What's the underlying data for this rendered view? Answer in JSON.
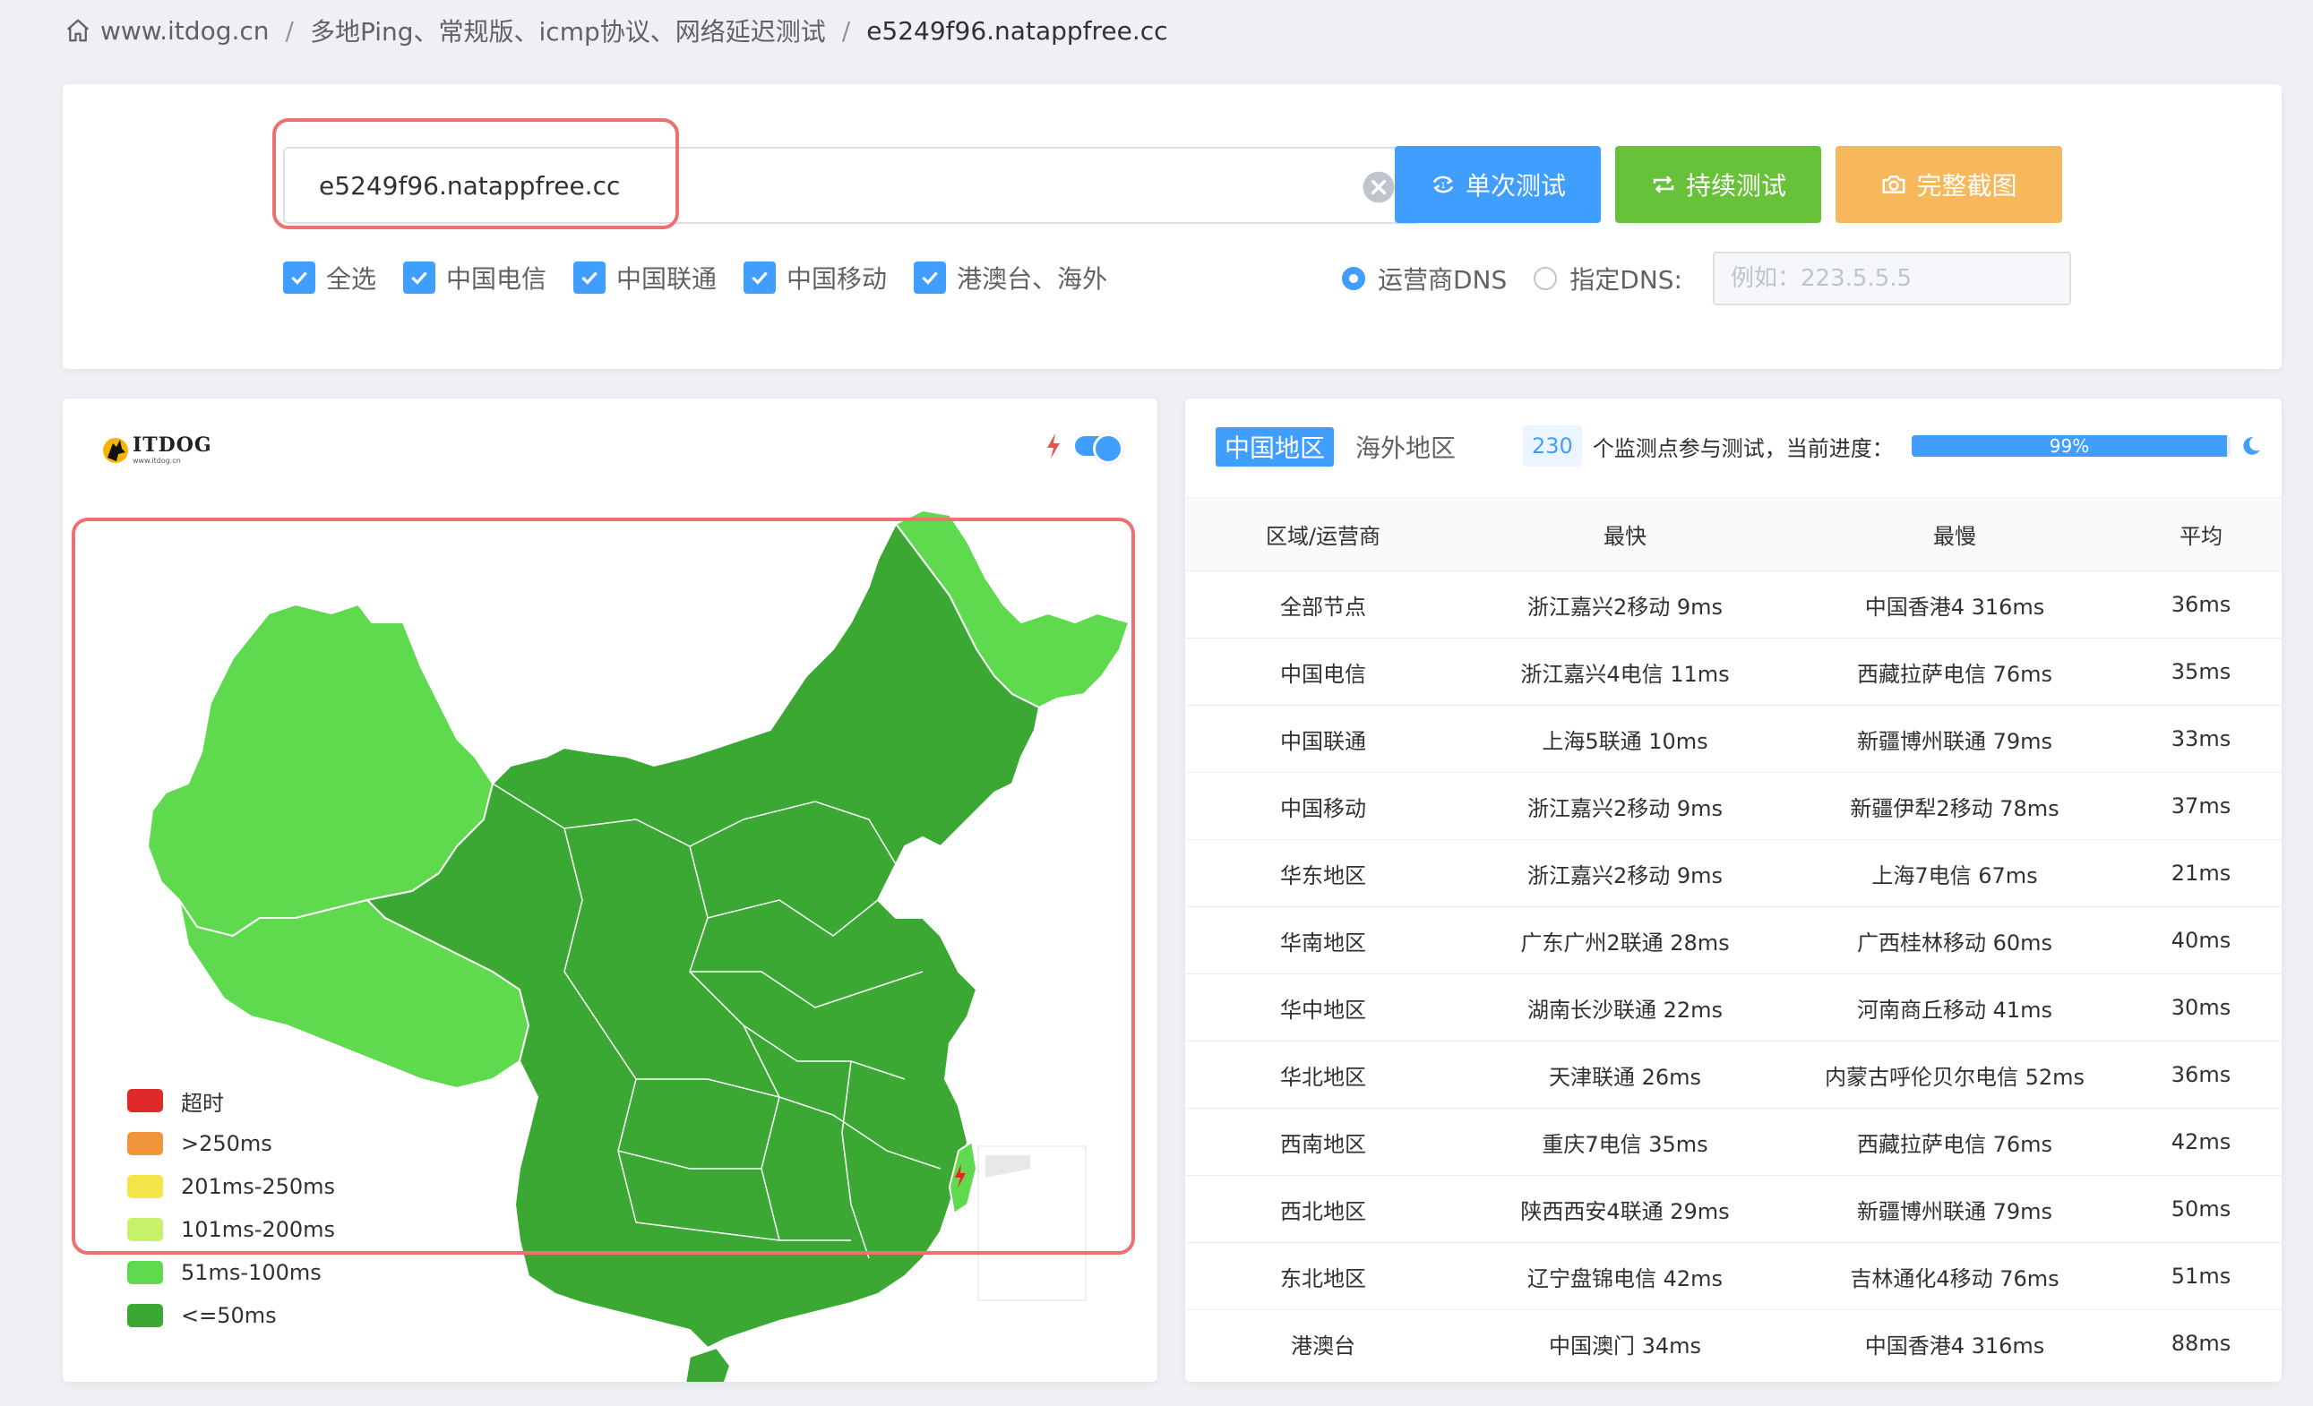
{
  "breadcrumb": {
    "items": [
      "www.itdog.cn",
      "多地Ping、常规版、icmp协议、网络延迟测试",
      "e5249f96.natappfree.cc"
    ],
    "separator": "/"
  },
  "search": {
    "host_value": "e5249f96.natappfree.cc",
    "clear_icon": "close-circle-icon"
  },
  "buttons": {
    "single": "单次测试",
    "continuous": "持续测试",
    "screenshot": "完整截图"
  },
  "isp_checks": [
    {
      "label": "全选",
      "checked": true
    },
    {
      "label": "中国电信",
      "checked": true
    },
    {
      "label": "中国联通",
      "checked": true
    },
    {
      "label": "中国移动",
      "checked": true
    },
    {
      "label": "港澳台、海外",
      "checked": true
    }
  ],
  "dns": {
    "isp_dns_label": "运营商DNS",
    "isp_dns_selected": true,
    "custom_dns_label": "指定DNS:",
    "custom_dns_placeholder": "例如：223.5.5.5"
  },
  "map": {
    "logo_name": "ITDOG",
    "logo_sub": "www.itdog.cn",
    "legend": [
      {
        "label": "超时",
        "color": "#e02a2a"
      },
      {
        "label": ">250ms",
        "color": "#f0953b"
      },
      {
        "label": "201ms-250ms",
        "color": "#f4e64a"
      },
      {
        "label": "101ms-200ms",
        "color": "#c7f16a"
      },
      {
        "label": "51ms-100ms",
        "color": "#5fd94d"
      },
      {
        "label": "<=50ms",
        "color": "#3aa832"
      }
    ],
    "realtime_toggle_on": true
  },
  "results": {
    "tabs": {
      "active": "中国地区",
      "inactive": "海外地区"
    },
    "node_count": "230",
    "progress_text": "个监测点参与测试，当前进度：",
    "progress_percent": 99,
    "progress_label": "99%",
    "columns": [
      "区域/运营商",
      "最快",
      "最慢",
      "平均"
    ],
    "rows": [
      [
        "全部节点",
        "浙江嘉兴2移动 9ms",
        "中国香港4 316ms",
        "36ms"
      ],
      [
        "中国电信",
        "浙江嘉兴4电信 11ms",
        "西藏拉萨电信 76ms",
        "35ms"
      ],
      [
        "中国联通",
        "上海5联通 10ms",
        "新疆博州联通 79ms",
        "33ms"
      ],
      [
        "中国移动",
        "浙江嘉兴2移动 9ms",
        "新疆伊犁2移动 78ms",
        "37ms"
      ],
      [
        "华东地区",
        "浙江嘉兴2移动 9ms",
        "上海7电信 67ms",
        "21ms"
      ],
      [
        "华南地区",
        "广东广州2联通 28ms",
        "广西桂林移动 60ms",
        "40ms"
      ],
      [
        "华中地区",
        "湖南长沙联通 22ms",
        "河南商丘移动 41ms",
        "30ms"
      ],
      [
        "华北地区",
        "天津联通 26ms",
        "内蒙古呼伦贝尔电信 52ms",
        "36ms"
      ],
      [
        "西南地区",
        "重庆7电信 35ms",
        "西藏拉萨电信 76ms",
        "42ms"
      ],
      [
        "西北地区",
        "陕西西安4联通 29ms",
        "新疆博州联通 79ms",
        "50ms"
      ],
      [
        "东北地区",
        "辽宁盘锦电信 42ms",
        "吉林通化4移动 76ms",
        "51ms"
      ],
      [
        "港澳台",
        "中国澳门 34ms",
        "中国香港4 316ms",
        "88ms"
      ]
    ]
  }
}
